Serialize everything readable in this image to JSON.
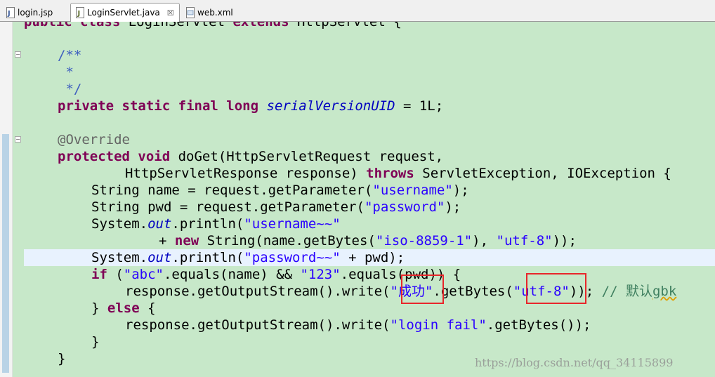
{
  "tabs": [
    {
      "label": "login.jsp",
      "icon": "jsp-file-icon",
      "active": false
    },
    {
      "label": "LoginServlet.java",
      "icon": "java-file-icon",
      "active": true,
      "close": "☒"
    },
    {
      "label": "web.xml",
      "icon": "xml-file-icon",
      "active": false
    }
  ],
  "code": {
    "l1": {
      "a": "public",
      "b": " ",
      "c": "class",
      "d": " LoginServlet ",
      "e": "extends",
      "f": " HttpServlet {"
    },
    "l3": {
      "a": "/**"
    },
    "l4": {
      "a": " *"
    },
    "l5": {
      "a": " */"
    },
    "l6": {
      "a": "private",
      "b": " ",
      "c": "static",
      "d": " ",
      "e": "final",
      "f": " ",
      "g": "long",
      "h": " ",
      "i": "serialVersionUID",
      "j": " = 1L;"
    },
    "l8": {
      "a": "@Override"
    },
    "l9": {
      "a": "protected",
      "b": " ",
      "c": "void",
      "d": " doGet(HttpServletRequest request,"
    },
    "l10": {
      "a": "HttpServletResponse response) ",
      "b": "throws",
      "c": " ServletException, IOException {"
    },
    "l11": {
      "a": "String name = request.getParameter(",
      "b": "\"username\"",
      "c": ");"
    },
    "l12": {
      "a": "String pwd = request.getParameter(",
      "b": "\"password\"",
      "c": ");"
    },
    "l13": {
      "a": "System.",
      "b": "out",
      "c": ".println(",
      "d": "\"username~~\""
    },
    "l14": {
      "a": "+ ",
      "b": "new",
      "c": " String(name.getBytes(",
      "d": "\"iso-8859-1\"",
      "e": "), ",
      "f": "\"utf-8\"",
      "g": "));"
    },
    "l15": {
      "a": "System.",
      "b": "out",
      "c": ".println(",
      "d": "\"password~~\"",
      "e": " + pwd);"
    },
    "l16": {
      "a": "if",
      "b": " (",
      "c": "\"abc\"",
      "d": ".equals(name) && ",
      "e": "\"123\"",
      "f": ".equals(pwd)) {"
    },
    "l17": {
      "a": "response.getOutputStream().write(",
      "b": "\"成功\"",
      "c": ".getBytes(",
      "d": "\"utf-8\"",
      "e": ")); ",
      "f": "// 默认",
      "g": "gbk"
    },
    "l18": {
      "a": "} ",
      "b": "else",
      "c": " {"
    },
    "l19": {
      "a": "response.getOutputStream().write(",
      "b": "\"login fail\"",
      "c": ".getBytes());"
    },
    "l20": {
      "a": "}"
    },
    "l21": {
      "a": "}"
    }
  },
  "watermark": "https://blog.csdn.net/qq_34115899",
  "colors": {
    "editor_bg": "#c7e8c9",
    "keyword": "#7f0055",
    "string": "#2a00ff",
    "comment": "#3f5fbf",
    "line_comment": "#3f7f5f",
    "highlight_box": "#e8262a"
  }
}
